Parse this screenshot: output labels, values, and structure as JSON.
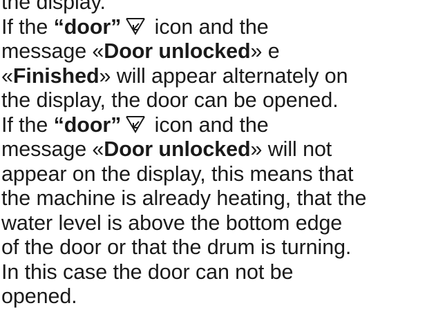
{
  "document": {
    "lines": {
      "l0": "the display.",
      "l1_a": "If the ",
      "l1_b": "“door”",
      "l1_c": " icon and the",
      "l2_a": "message «",
      "l2_b": "Door unlocked",
      "l2_c": "» e",
      "l3_a": "«",
      "l3_b": "Finished",
      "l3_c": "» will appear alternately on",
      "l4": "the display, the door can be opened.",
      "l5_a": "If the ",
      "l5_b": "“door”",
      "l5_c": " icon and the",
      "l6_a": "message «",
      "l6_b": "Door unlocked",
      "l6_c": "» will not",
      "l7": "appear on the display, this means that",
      "l8": "the machine is already heating, that the",
      "l9": "water level is above the bottom edge",
      "l10": "of the door or that the drum is turning.",
      "l11": "In this case the door can not be",
      "l12": "opened."
    },
    "icon": "door-unlock-icon",
    "text_color": "#1a1a1a"
  }
}
